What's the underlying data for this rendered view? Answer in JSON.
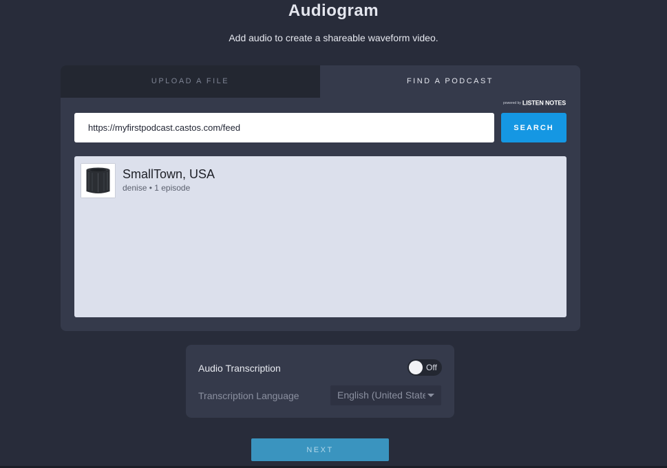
{
  "header": {
    "title": "Audiogram",
    "subtitle": "Add audio to create a shareable waveform video."
  },
  "tabs": [
    {
      "label": "UPLOAD A FILE",
      "active": false
    },
    {
      "label": "FIND A PODCAST",
      "active": true
    }
  ],
  "powered_by": {
    "prefix": "powered by",
    "brand": "LISTEN NOTES"
  },
  "search": {
    "value": "https://myfirstpodcast.castos.com/feed",
    "button_label": "SEARCH"
  },
  "results": [
    {
      "name": "SmallTown, USA",
      "meta": "denise • 1 episode",
      "thumbnail_icon": "microphone-windscreen-icon"
    }
  ],
  "settings": {
    "transcription_label": "Audio Transcription",
    "transcription_toggle": "Off",
    "language_label": "Transcription Language",
    "language_value": "English (United States)"
  },
  "next_label": "NEXT",
  "colors": {
    "background": "#282c3a",
    "card": "#353a4b",
    "accent": "#1597e3",
    "next_button": "#3a94bf"
  }
}
